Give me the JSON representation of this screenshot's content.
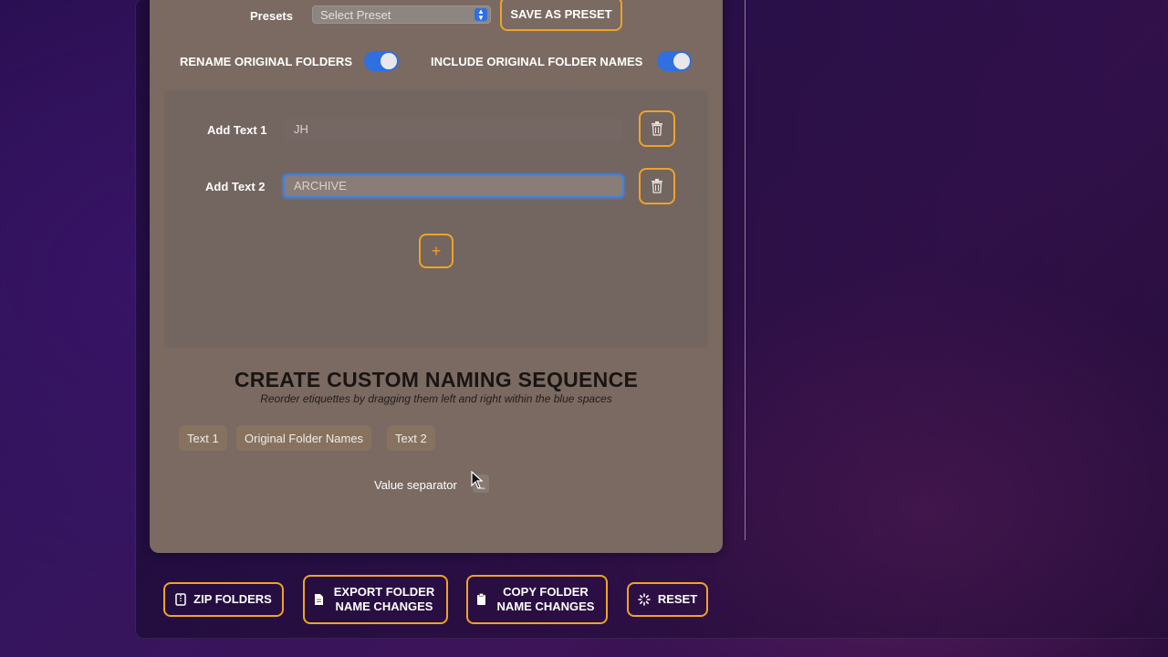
{
  "presets": {
    "label": "Presets",
    "select_value": "Select Preset",
    "save_label": "SAVE AS PRESET"
  },
  "toggles": {
    "rename_original_label": "RENAME ORIGINAL FOLDERS",
    "rename_original_on": true,
    "include_names_label": "INCLUDE ORIGINAL FOLDER NAMES",
    "include_names_on": true
  },
  "text_fields": [
    {
      "label": "Add Text 1",
      "value": "JH"
    },
    {
      "label": "Add Text 2",
      "value": "ARCHIVE"
    }
  ],
  "add_button_glyph": "+",
  "sequence": {
    "title": "CREATE CUSTOM NAMING SEQUENCE",
    "subtitle": "Reorder etiquettes by dragging them left and right within the blue spaces",
    "chips": [
      "Text 1",
      "Original Folder Names",
      "Text 2"
    ],
    "separator_label": "Value separator",
    "separator_value": "_"
  },
  "footer": {
    "zip": "ZIP FOLDERS",
    "export": "EXPORT FOLDER NAME CHANGES",
    "copy": "COPY FOLDER NAME CHANGES",
    "reset": "RESET"
  },
  "colors": {
    "accent_orange": "#f0a326",
    "toggle_blue": "#2f6fe0",
    "panel": "#7a6a62"
  }
}
